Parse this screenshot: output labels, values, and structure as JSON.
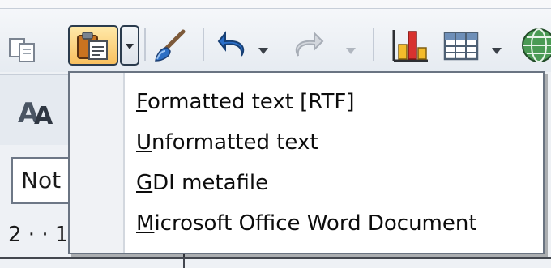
{
  "toolbar": {
    "buttons": [
      {
        "name": "copy",
        "icon": "copy-icon"
      },
      {
        "name": "paste",
        "icon": "paste-icon"
      },
      {
        "name": "paste-special-dropdown",
        "icon": "chevron-down-icon"
      },
      {
        "name": "clone-formatting",
        "icon": "brush-icon"
      },
      {
        "name": "undo",
        "icon": "undo-icon"
      },
      {
        "name": "redo",
        "icon": "redo-icon"
      },
      {
        "name": "insert-chart",
        "icon": "chart-icon"
      },
      {
        "name": "insert-table",
        "icon": "table-icon"
      },
      {
        "name": "hyperlink",
        "icon": "globe-icon"
      }
    ]
  },
  "format_bar": {
    "style_box_value": "Not",
    "ruler_text": "2 · · 1"
  },
  "paste_menu": {
    "items": [
      {
        "accelerator": "F",
        "rest": "ormatted text [RTF]"
      },
      {
        "accelerator": "U",
        "rest": "nformatted text"
      },
      {
        "accelerator": "G",
        "rest": "DI metafile"
      },
      {
        "accelerator": "M",
        "rest": "icrosoft Office Word Document"
      }
    ]
  },
  "colors": {
    "toolbar_bg": "#e9eef4",
    "menu_border": "#6a7482",
    "paste_highlight": "#f8c05f",
    "chart_red": "#d8322f",
    "chart_yellow": "#f3bb2b"
  }
}
